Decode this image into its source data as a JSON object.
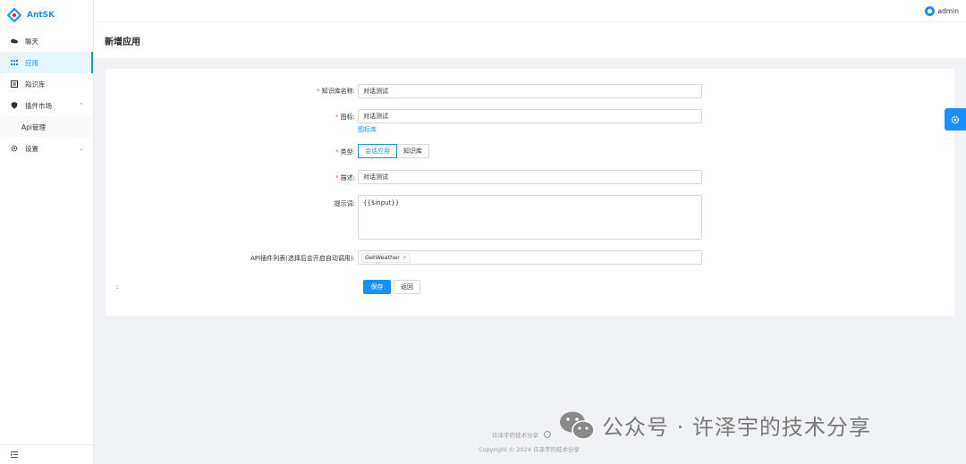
{
  "app": {
    "name": "AntSK"
  },
  "header": {
    "user": "admin"
  },
  "sidebar": {
    "items": [
      {
        "label": "聊天"
      },
      {
        "label": "应用"
      },
      {
        "label": "知识库"
      },
      {
        "label": "插件市场"
      },
      {
        "label": "Api管理"
      },
      {
        "label": "设置"
      }
    ]
  },
  "page": {
    "title": "新增应用"
  },
  "form": {
    "name": {
      "label": "知识库名称:",
      "value": "对话测试"
    },
    "icon": {
      "label": "图标:",
      "value": "对话测试",
      "link": "图标库"
    },
    "type": {
      "label": "类型:",
      "options": [
        "会话应用",
        "知识库"
      ],
      "selected": "会话应用"
    },
    "desc": {
      "label": "描述:",
      "value": "对话测试"
    },
    "prompt": {
      "label": "提示词:",
      "value": "{{$input}}"
    },
    "api_plugins": {
      "label": "API插件列表(选择后会开启自动调用):",
      "tags": [
        "GetWeather"
      ]
    },
    "colon_label": ":",
    "save": "保存",
    "back": "返回"
  },
  "footer": {
    "link": "许泽宇的技术分享",
    "copyright": "Copyright © 2024 许泽宇的技术分享"
  },
  "watermark": {
    "text": "公众号 · 许泽宇的技术分享"
  },
  "colors": {
    "primary": "#1890ff",
    "required": "#ff4d4f"
  }
}
